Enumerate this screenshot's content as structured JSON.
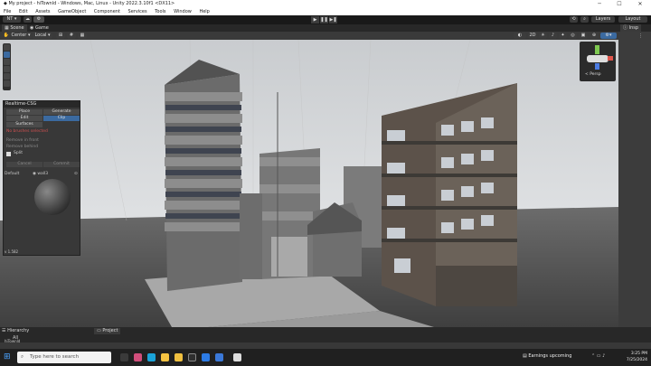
{
  "window": {
    "title": "My project - hiTownld - Windows, Mac, Linux - Unity 2022.3.10f1 <DX11>",
    "minimize": "─",
    "maximize": "☐",
    "close": "✕"
  },
  "menu": [
    "File",
    "Edit",
    "Assets",
    "GameObject",
    "Component",
    "Services",
    "Tools",
    "Window",
    "Help"
  ],
  "toolbar": {
    "account": "NT ▾",
    "cloud": "☁",
    "play": "▶",
    "pause": "❚❚",
    "step": "▶❚",
    "layers": "Layers",
    "layout": "Layout",
    "history": "⟲",
    "search": "⌕"
  },
  "tabs": {
    "scene": "Scene",
    "game": "Game",
    "inspector": "Insp"
  },
  "scene_toolbar": {
    "pivot": "Center ▾",
    "space": "Local ▾",
    "mode_2d": "2D"
  },
  "gizmo": {
    "label": "< Persp"
  },
  "realtime_csg": {
    "title": "Realtime-CSG",
    "place": "Place",
    "generate": "Generate",
    "edit": "Edit",
    "clip": "Clip",
    "surfaces": "Surfaces",
    "warning": "No brushes selected",
    "remove_front": "Remove in front",
    "remove_behind": "Remove behind",
    "split": "Split",
    "cancel": "Cancel",
    "commit": "Commit",
    "default_label": "Default",
    "material": "wall3",
    "version": "v 1.582"
  },
  "bottom": {
    "hierarchy": "Hierarchy",
    "project": "Project",
    "all": "All",
    "scene_item": "hiTownld"
  },
  "taskbar": {
    "search_placeholder": "Type here to search",
    "weather": "Earnings upcoming",
    "time": "3:25 PM",
    "date": "7/25/2024"
  }
}
